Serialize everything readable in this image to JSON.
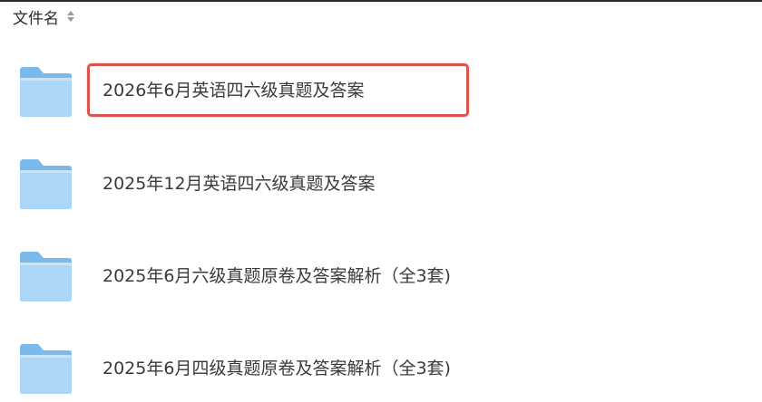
{
  "header": {
    "column_label": "文件名"
  },
  "files": [
    {
      "name": "2026年6月英语四六级真题及答案",
      "icon": "folder-icon",
      "highlighted": true
    },
    {
      "name": "2025年12月英语四六级真题及答案",
      "icon": "folder-icon",
      "highlighted": false
    },
    {
      "name": "2025年6月六级真题原卷及答案解析（全3套)",
      "icon": "folder-icon",
      "highlighted": false
    },
    {
      "name": "2025年6月四级真题原卷及答案解析（全3套)",
      "icon": "folder-icon",
      "highlighted": false
    }
  ],
  "colors": {
    "highlight_border": "#d9534f",
    "folder_light": "#a9d4f5",
    "folder_dark": "#6fb1e8"
  }
}
